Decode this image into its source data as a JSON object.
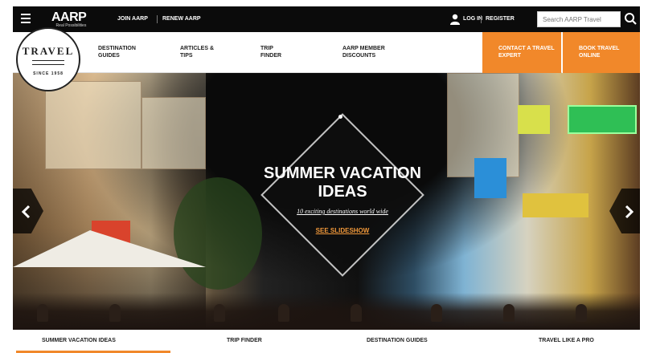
{
  "topbar": {
    "logo_main": "AARP",
    "logo_tag": "Real Possibilities",
    "join_label": "JOIN AARP",
    "renew_label": "RENEW AARP",
    "login_label": "LOG IN",
    "register_label": "REGISTER",
    "search_placeholder": "Search AARP Travel"
  },
  "badge": {
    "title": "TRAVEL",
    "subtitle": "SINCE 1958"
  },
  "nav": {
    "items": [
      {
        "label": "DESTINATION GUIDES"
      },
      {
        "label": "ARTICLES & TIPS"
      },
      {
        "label": "TRIP FINDER"
      },
      {
        "label": "AARP MEMBER DISCOUNTS"
      }
    ],
    "contact_label": "CONTACT A TRAVEL EXPERT",
    "book_label": "BOOK TRAVEL ONLINE"
  },
  "hero": {
    "title": "SUMMER VACATION IDEAS",
    "subtitle": "10 exciting destinations world wide",
    "cta": "SEE SLIDESHOW"
  },
  "bottom": {
    "items": [
      {
        "label": "SUMMER VACATION IDEAS"
      },
      {
        "label": "TRIP FINDER"
      },
      {
        "label": "DESTINATION GUIDES"
      },
      {
        "label": "TRAVEL LIKE A PRO"
      }
    ]
  },
  "colors": {
    "accent": "#f1882a",
    "topbar": "#0b0b0b"
  },
  "icons": [
    "menu-icon",
    "user-icon",
    "search-icon",
    "chevron-left-icon",
    "chevron-right-icon"
  ]
}
